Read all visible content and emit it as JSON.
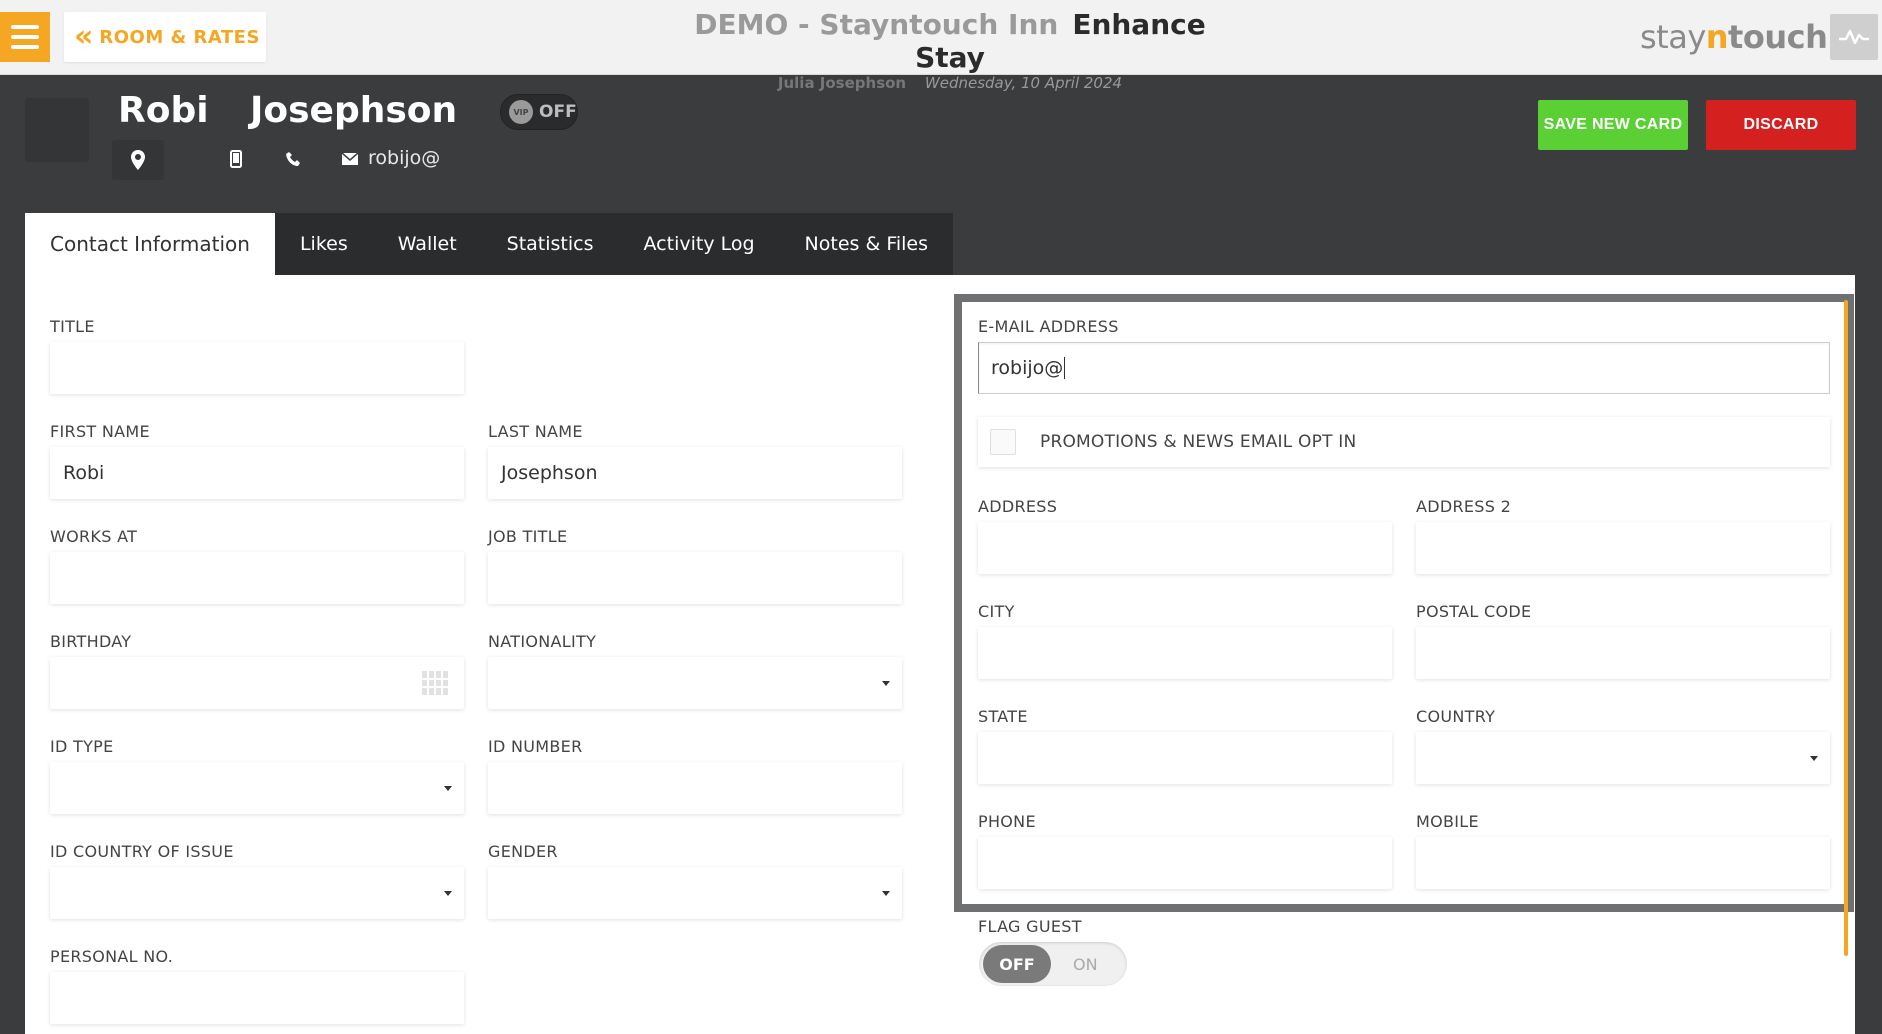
{
  "header": {
    "back_label": "ROOM & RATES",
    "hotel_name": "DEMO - Stayntouch Inn",
    "page_name": "Enhance Stay",
    "user_name": "Julia Josephson",
    "date": "Wednesday, 10 April 2024",
    "logo_part1": "stay",
    "logo_part2": "n",
    "logo_part3": "touch"
  },
  "guest": {
    "first_name": "Robi",
    "last_name": "Josephson",
    "email": "robijo@",
    "vip_label": "VIP",
    "vip_state": "OFF"
  },
  "actions": {
    "save_label": "SAVE NEW CARD",
    "discard_label": "DISCARD"
  },
  "tabs": [
    {
      "label": "Contact Information"
    },
    {
      "label": "Likes"
    },
    {
      "label": "Wallet"
    },
    {
      "label": "Statistics"
    },
    {
      "label": "Activity Log"
    },
    {
      "label": "Notes & Files"
    }
  ],
  "form": {
    "title_label": "TITLE",
    "title_value": "",
    "first_name_label": "FIRST NAME",
    "first_name_value": "Robi",
    "last_name_label": "LAST NAME",
    "last_name_value": "Josephson",
    "works_at_label": "WORKS AT",
    "job_title_label": "JOB TITLE",
    "birthday_label": "BIRTHDAY",
    "nationality_label": "NATIONALITY",
    "id_type_label": "ID TYPE",
    "id_number_label": "ID NUMBER",
    "id_country_label": "ID COUNTRY OF ISSUE",
    "gender_label": "GENDER",
    "personal_no_label": "PERSONAL NO.",
    "email_label": "E-MAIL ADDRESS",
    "email_value": "robijo@",
    "optin_label": "PROMOTIONS & NEWS EMAIL OPT IN",
    "address_label": "ADDRESS",
    "address2_label": "ADDRESS 2",
    "city_label": "CITY",
    "postal_label": "POSTAL CODE",
    "state_label": "STATE",
    "country_label": "COUNTRY",
    "phone_label": "PHONE",
    "mobile_label": "MOBILE",
    "flag_label": "FLAG GUEST",
    "flag_off": "OFF",
    "flag_on": "ON"
  },
  "colors": {
    "accent": "#f5a623",
    "save": "#5ad034",
    "discard": "#d52020",
    "dark_bg": "#3a3c3e"
  }
}
